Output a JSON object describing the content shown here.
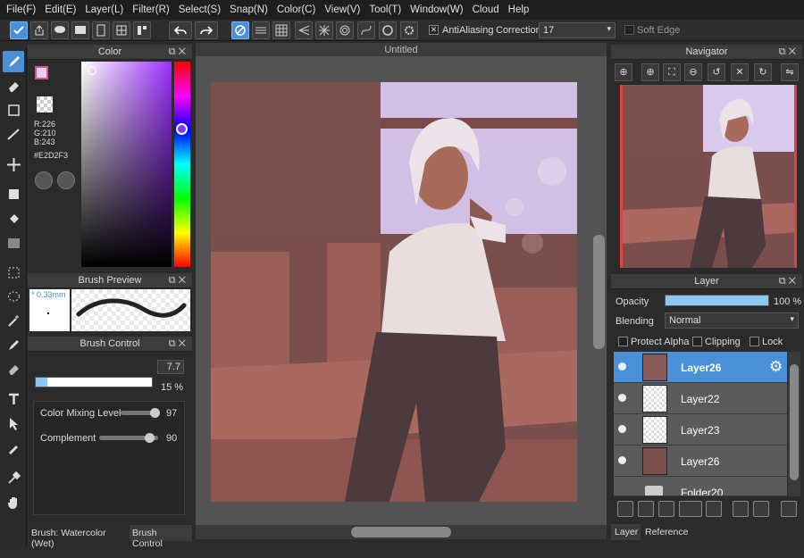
{
  "menu": [
    "File(F)",
    "Edit(E)",
    "Layer(L)",
    "Filter(R)",
    "Select(S)",
    "Snap(N)",
    "Color(C)",
    "View(V)",
    "Tool(T)",
    "Window(W)",
    "Cloud",
    "Help"
  ],
  "toolbar": {
    "antialiasing_label": "AntiAliasing",
    "correction_label": "Correction",
    "correction_value": "17",
    "soft_edge_label": "Soft Edge"
  },
  "color_panel": {
    "title": "Color",
    "r": "R:226",
    "g": "G:210",
    "b": "B:243",
    "hex": "#E2D2F3",
    "current_color": "#E2D2F3",
    "hue_color": "#9b30ff"
  },
  "brush_preview": {
    "title": "Brush Preview",
    "size": "* 0.33mm"
  },
  "brush_control": {
    "title": "Brush Control",
    "size_value": "7.7",
    "size_fill": 0.1,
    "opacity_value": "15 %",
    "opacity_fill": 0.12,
    "mixing_label": "Color Mixing Level",
    "mixing_value": "97",
    "mixing_level": 0.97,
    "complement_label": "Complement",
    "complement_value": "90",
    "complement_level": 0.9
  },
  "bottom_tabs": {
    "brush": "Brush: Watercolor (Wet)",
    "control": "Brush Control"
  },
  "canvas_tab": "Untitled",
  "navigator": {
    "title": "Navigator"
  },
  "layer_panel": {
    "title": "Layer",
    "opacity_label": "Opacity",
    "opacity_value": "100 %",
    "opacity_level": 1.0,
    "blending_label": "Blending",
    "blending_value": "Normal",
    "protect_alpha": "Protect Alpha",
    "clipping": "Clipping",
    "lock": "Lock",
    "layers": [
      {
        "name": "Layer26",
        "selected": true
      },
      {
        "name": "Layer22",
        "selected": false
      },
      {
        "name": "Layer23",
        "selected": false
      },
      {
        "name": "Layer26",
        "selected": false
      },
      {
        "name": "Folder20",
        "selected": false
      }
    ]
  },
  "right_tabs": {
    "layer": "Layer",
    "reference": "Reference"
  },
  "colors": {
    "accent": "#4a90d9",
    "panel": "#2b2b2b",
    "header": "#3c3c3c"
  }
}
